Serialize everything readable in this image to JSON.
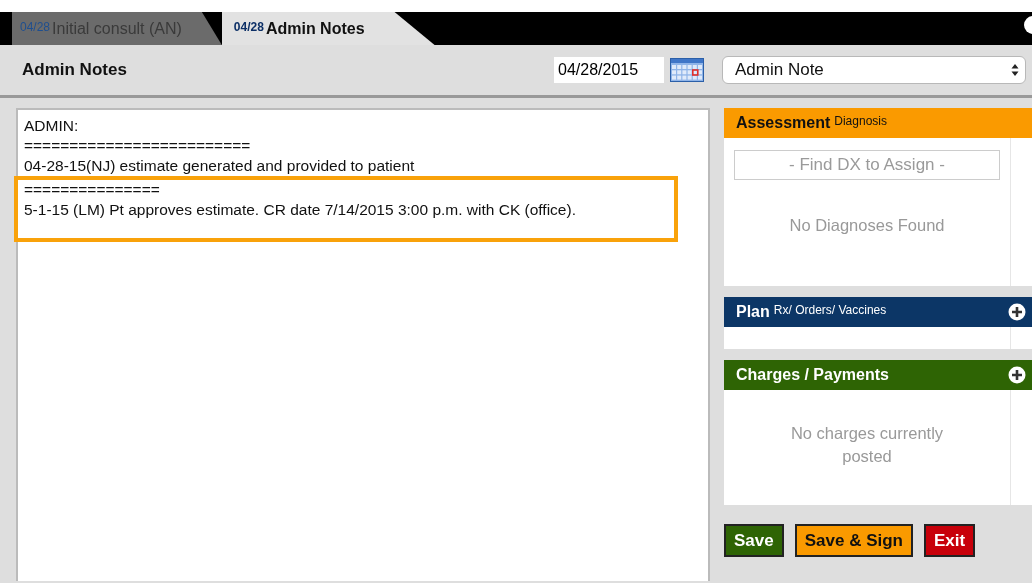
{
  "tabs": [
    {
      "date": "04/28",
      "label": "Initial consult (AN)",
      "selected": false
    },
    {
      "date": "04/28",
      "label": "Admin Notes",
      "selected": true
    }
  ],
  "header": {
    "title": "Admin Notes",
    "date_field": {
      "value": "04/28/2015"
    },
    "note_type": {
      "value": "Admin Note"
    }
  },
  "note": {
    "blocks": [
      {
        "highlighted": false,
        "lines": [
          "ADMIN:",
          "=========================",
          "04-28-15(NJ) estimate generated and provided to patient"
        ]
      },
      {
        "highlighted": true,
        "lines": [
          "===============",
          "5-1-15 (LM) Pt approves estimate.  CR date 7/14/2015 3:00 p.m. with CK (office)."
        ]
      }
    ]
  },
  "panels": [
    {
      "kind": "assessment",
      "title": "Assessment",
      "subtitle": "Diagnosis",
      "color": "#fa9a00",
      "add_button": false,
      "search": {
        "placeholder": "- Find DX to Assign -"
      },
      "message": "No Diagnoses Found"
    },
    {
      "kind": "plan",
      "title": "Plan",
      "subtitle": "Rx/ Orders/ Vaccines",
      "color": "#0c3666",
      "add_button": true
    },
    {
      "kind": "charges",
      "title": "Charges / Payments",
      "color": "#2e6404",
      "add_button": true,
      "message": "No charges currently posted"
    }
  ],
  "buttons": [
    {
      "label": "Save",
      "color": "#2e6404"
    },
    {
      "label": "Save & Sign",
      "color": "#fa9a00"
    },
    {
      "label": "Exit",
      "color": "#c8000a"
    }
  ]
}
